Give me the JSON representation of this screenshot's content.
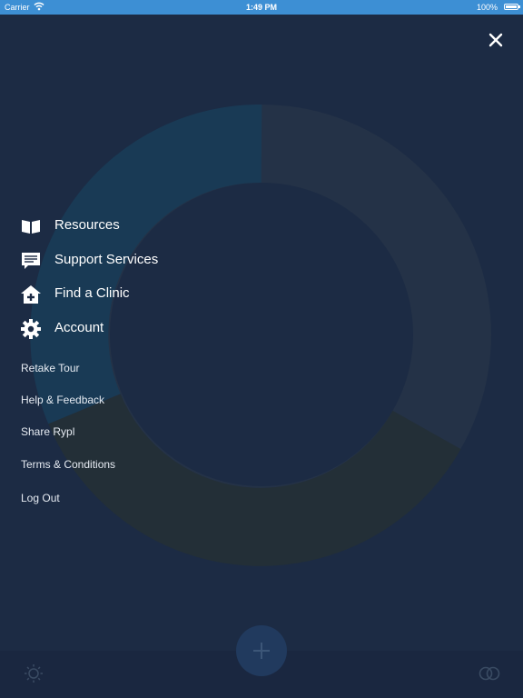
{
  "status_bar": {
    "carrier": "Carrier",
    "time": "1:49 PM",
    "battery": "100%"
  },
  "colors": {
    "status_bar": "#3d8fd4",
    "background": "#1c2b44",
    "ring_blue": "#193a55",
    "ring_gray": "#243247",
    "ring_olive": "#232f37"
  },
  "menu": {
    "main_items": [
      {
        "label": "Resources",
        "icon": "book-icon"
      },
      {
        "label": "Support Services",
        "icon": "chat-icon"
      },
      {
        "label": "Find a Clinic",
        "icon": "clinic-icon"
      },
      {
        "label": "Account",
        "icon": "gear-icon"
      }
    ],
    "secondary_items": [
      {
        "label": "Retake Tour"
      },
      {
        "label": "Help & Feedback"
      },
      {
        "label": "Share Rypl"
      },
      {
        "label": "Terms & Conditions"
      },
      {
        "label": "Log Out"
      }
    ]
  },
  "bottom_bar": {
    "add_icon": "plus-icon",
    "left_icon": "sun-icon",
    "right_icon": "rings-icon"
  }
}
